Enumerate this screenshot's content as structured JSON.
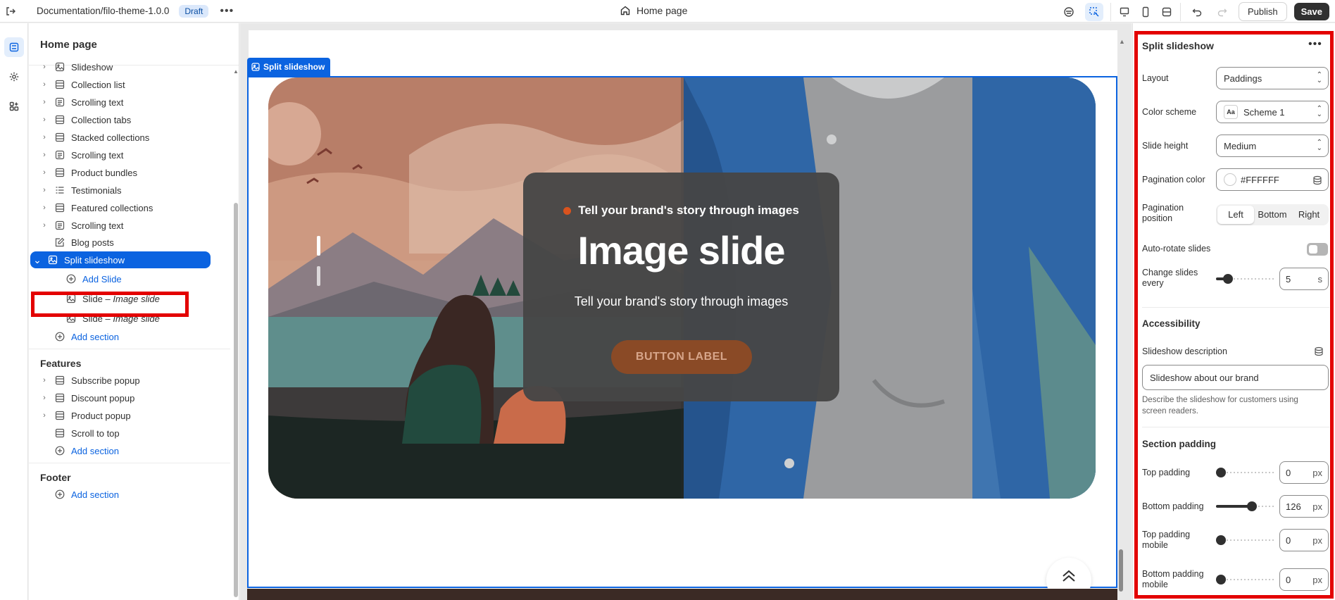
{
  "topbar": {
    "theme_name": "Documentation/filo-theme-1.0.0",
    "status": "Draft",
    "page": "Home page",
    "publish_label": "Publish",
    "save_label": "Save"
  },
  "sidebar": {
    "title": "Home page",
    "template_items": [
      {
        "label": "Slideshow",
        "icon": "slideshow-icon"
      },
      {
        "label": "Collection list",
        "icon": "section-icon"
      },
      {
        "label": "Scrolling text",
        "icon": "text-icon"
      },
      {
        "label": "Collection tabs",
        "icon": "section-icon"
      },
      {
        "label": "Stacked collections",
        "icon": "section-icon"
      },
      {
        "label": "Scrolling text",
        "icon": "text-icon"
      },
      {
        "label": "Product bundles",
        "icon": "section-icon"
      },
      {
        "label": "Testimonials",
        "icon": "list-icon"
      },
      {
        "label": "Featured collections",
        "icon": "section-icon"
      },
      {
        "label": "Scrolling text",
        "icon": "text-icon"
      }
    ],
    "blog_posts": "Blog posts",
    "selected": "Split slideshow",
    "add_slide": "Add Slide",
    "slides": [
      {
        "prefix": "Slide – ",
        "name": "Image slide"
      },
      {
        "prefix": "Slide – ",
        "name": "Image slide"
      }
    ],
    "add_section": "Add section",
    "features_heading": "Features",
    "features": [
      {
        "label": "Subscribe popup"
      },
      {
        "label": "Discount popup"
      },
      {
        "label": "Product popup"
      },
      {
        "label": "Scroll to top"
      }
    ],
    "footer_heading": "Footer"
  },
  "canvas": {
    "section_tag": "Split slideshow",
    "slide": {
      "subheading": "Tell your brand's story through images",
      "heading": "Image slide",
      "text": "Tell your brand's story through images",
      "button": "BUTTON LABEL"
    }
  },
  "settings": {
    "title": "Split slideshow",
    "layout_label": "Layout",
    "layout_value": "Paddings",
    "color_scheme_label": "Color scheme",
    "color_scheme_value": "Scheme 1",
    "slide_height_label": "Slide height",
    "slide_height_value": "Medium",
    "pagination_color_label": "Pagination color",
    "pagination_color_value": "#FFFFFF",
    "pagination_position_label": "Pagination position",
    "pagination_options": [
      "Left",
      "Bottom",
      "Right"
    ],
    "pagination_selected": "Left",
    "auto_rotate_label": "Auto-rotate slides",
    "auto_rotate_on": false,
    "change_slides_label": "Change slides every",
    "change_slides_value": "5",
    "change_slides_unit": "s",
    "accessibility_heading": "Accessibility",
    "slideshow_desc_label": "Slideshow description",
    "slideshow_desc_value": "Slideshow about our brand",
    "slideshow_desc_help": "Describe the slideshow for customers using screen readers.",
    "section_padding_heading": "Section padding",
    "top_padding_label": "Top padding",
    "top_padding_value": "0",
    "bottom_padding_label": "Bottom padding",
    "bottom_padding_value": "126",
    "top_padding_mobile_label": "Top padding mobile",
    "top_padding_mobile_value": "0",
    "bottom_padding_mobile_label": "Bottom padding mobile",
    "bottom_padding_mobile_value": "0",
    "px_unit": "px"
  }
}
